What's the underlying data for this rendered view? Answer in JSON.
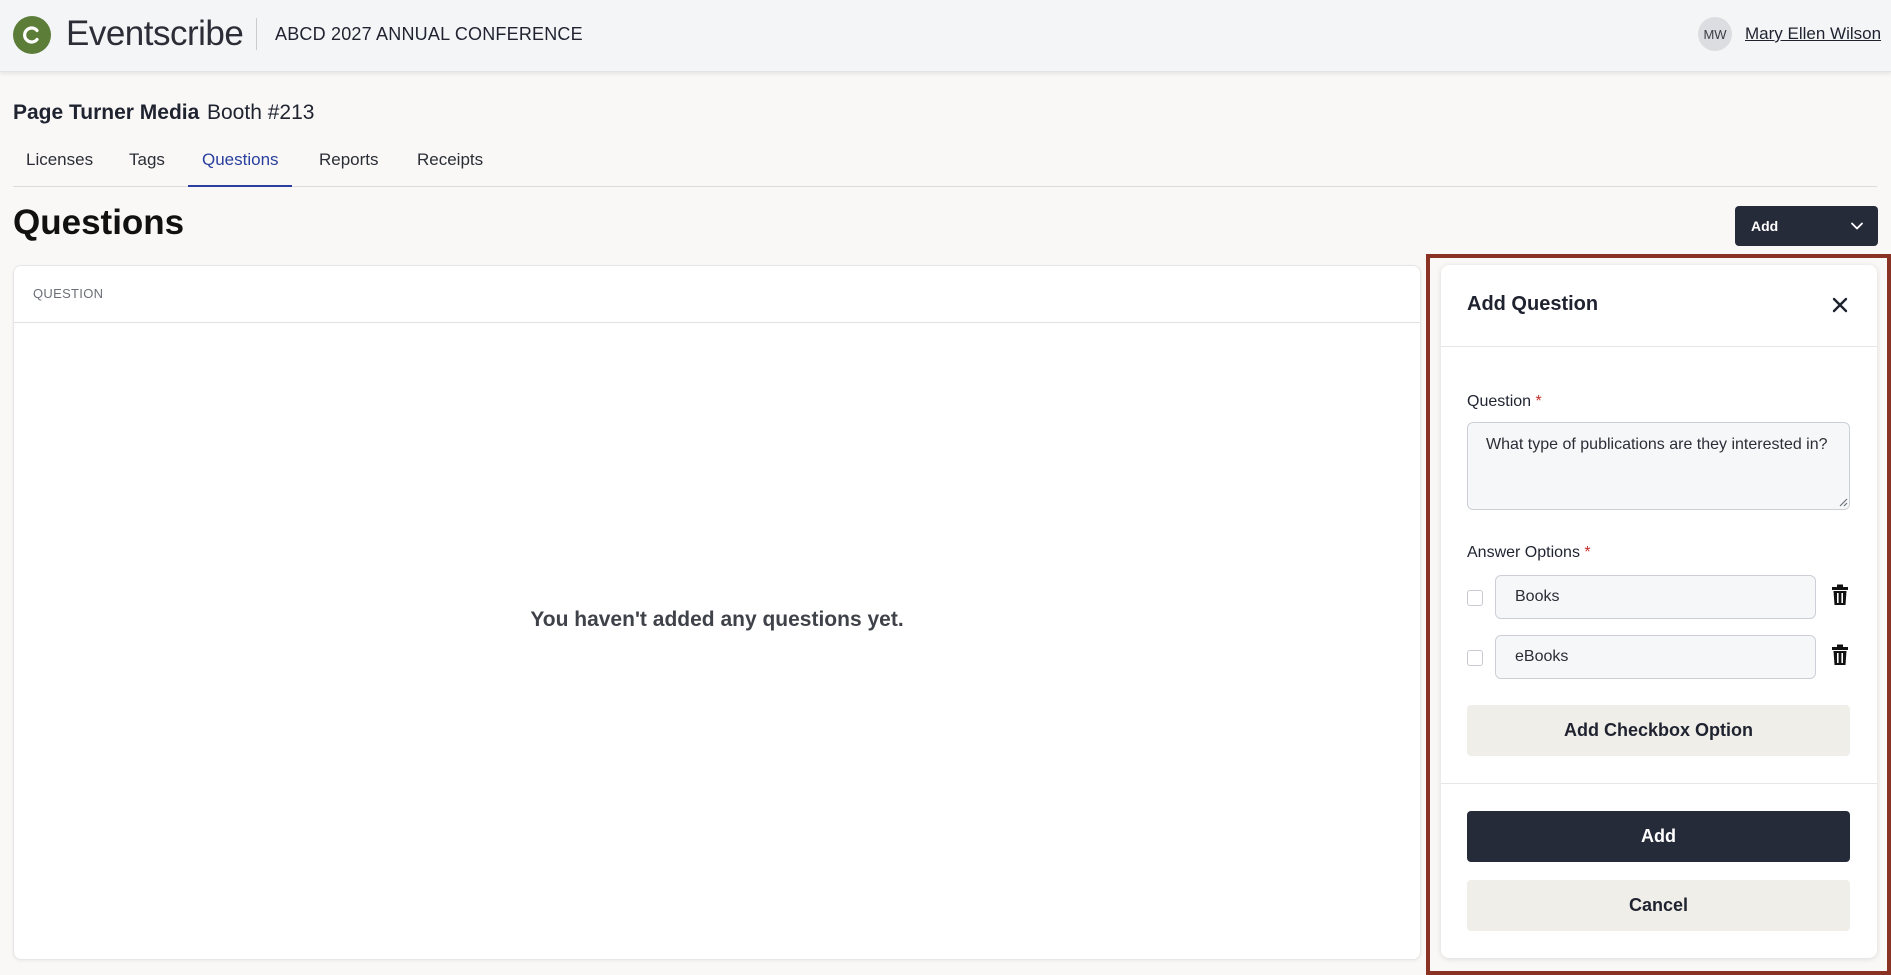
{
  "app": {
    "logo_letter": "C",
    "brand_name": "Eventscribe",
    "event_title": "ABCD 2027 ANNUAL CONFERENCE",
    "brand_color": "#5b7d38"
  },
  "user": {
    "initials": "MW",
    "name": "Mary Ellen Wilson"
  },
  "exhibitor": {
    "company": "Page Turner Media",
    "booth": "Booth #213"
  },
  "tabs": [
    {
      "label": "Licenses",
      "active": false
    },
    {
      "label": "Tags",
      "active": false
    },
    {
      "label": "Questions",
      "active": true
    },
    {
      "label": "Reports",
      "active": false
    },
    {
      "label": "Receipts",
      "active": false
    }
  ],
  "main": {
    "title": "Questions",
    "add_dropdown_label": "Add",
    "table": {
      "columns": [
        "QUESTION"
      ],
      "rows": [],
      "empty_message": "You haven't added any questions yet."
    }
  },
  "panel": {
    "title": "Add Question",
    "question_label": "Question",
    "required_mark": "*",
    "question_value": "What type of publications are they interested in?",
    "answer_options_label": "Answer Options",
    "options": [
      {
        "value": "Books",
        "checked": false
      },
      {
        "value": "eBooks",
        "checked": false
      }
    ],
    "add_option_label": "Add Checkbox Option",
    "submit_label": "Add",
    "cancel_label": "Cancel",
    "highlight_color": "#8a3324"
  }
}
